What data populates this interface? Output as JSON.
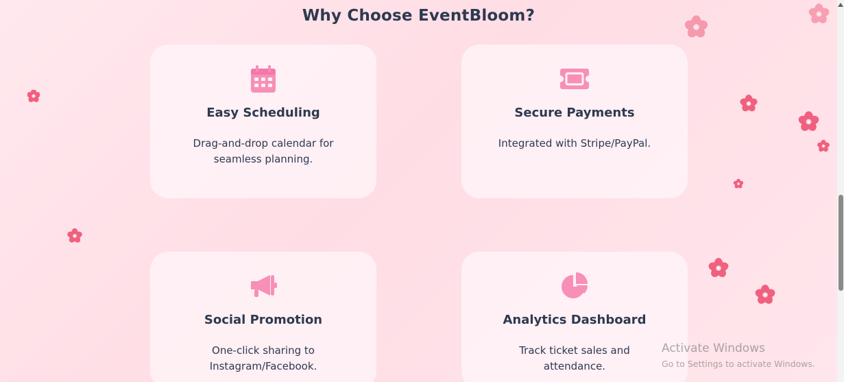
{
  "section": {
    "title": "Why Choose EventBloom?"
  },
  "features": [
    {
      "icon": "calendar-icon",
      "title": "Easy Scheduling",
      "description": "Drag-and-drop calendar for seamless planning."
    },
    {
      "icon": "ticket-icon",
      "title": "Secure Payments",
      "description": "Integrated with Stripe/PayPal."
    },
    {
      "icon": "megaphone-icon",
      "title": "Social Promotion",
      "description": "One-click sharing to Instagram/Facebook."
    },
    {
      "icon": "pie-chart-icon",
      "title": "Analytics Dashboard",
      "description": "Track ticket sales and attendance."
    }
  ],
  "watermark": {
    "title": "Activate Windows",
    "subtitle": "Go to Settings to activate Windows."
  },
  "colors": {
    "background": "#ffe4ea",
    "card": "#fff3f6",
    "icon_pink": "#f78fb7",
    "heading": "#2d3a4f",
    "flower": "#f0607f"
  },
  "decorations": {
    "flower_icon": "cherry-blossom-icon"
  }
}
